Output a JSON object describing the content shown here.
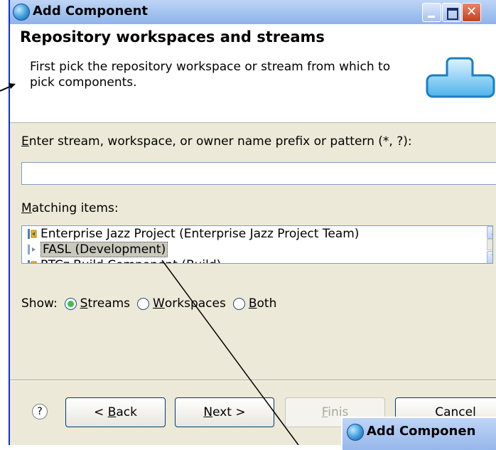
{
  "window": {
    "title": "Add Component"
  },
  "banner": {
    "title": "Repository workspaces and streams",
    "description": "First pick the repository workspace or stream from which to pick components."
  },
  "form": {
    "pattern_label_accel": "E",
    "pattern_label_rest": "nter stream, workspace, or owner name prefix or pattern (*, ?):",
    "pattern_value": "",
    "matching_label_accel": "M",
    "matching_label_rest": "atching items:",
    "items": [
      {
        "text": "Enterprise Jazz Project (Enterprise Jazz Project Team)"
      },
      {
        "text": "FASL (Development)"
      },
      {
        "text": "RTCz Build Component (Build)"
      }
    ],
    "show_label": "Show:",
    "radios": [
      {
        "accel": "S",
        "rest": "treams",
        "checked": true
      },
      {
        "accel": "W",
        "rest": "orkspaces",
        "checked": false
      },
      {
        "accel": "B",
        "rest": "oth",
        "checked": false
      }
    ]
  },
  "buttons": {
    "help": "?",
    "back_prefix": "< ",
    "back_accel": "B",
    "back_rest": "ack",
    "next_accel": "N",
    "next_rest": "ext >",
    "finish_accel": "F",
    "finish_rest": "inis",
    "cancel": "Cancel"
  },
  "second_window": {
    "title": "Add Componen"
  },
  "colors": {
    "dialog_bg": "#ece9d8",
    "titlebar": "#a9c7f0",
    "selection": "#c9c8bd",
    "radio_checked": "#3fbf4a"
  },
  "icons": {
    "title": "component-globe-icon",
    "banner": "component-tee-icon",
    "stream": "stream-icon"
  }
}
